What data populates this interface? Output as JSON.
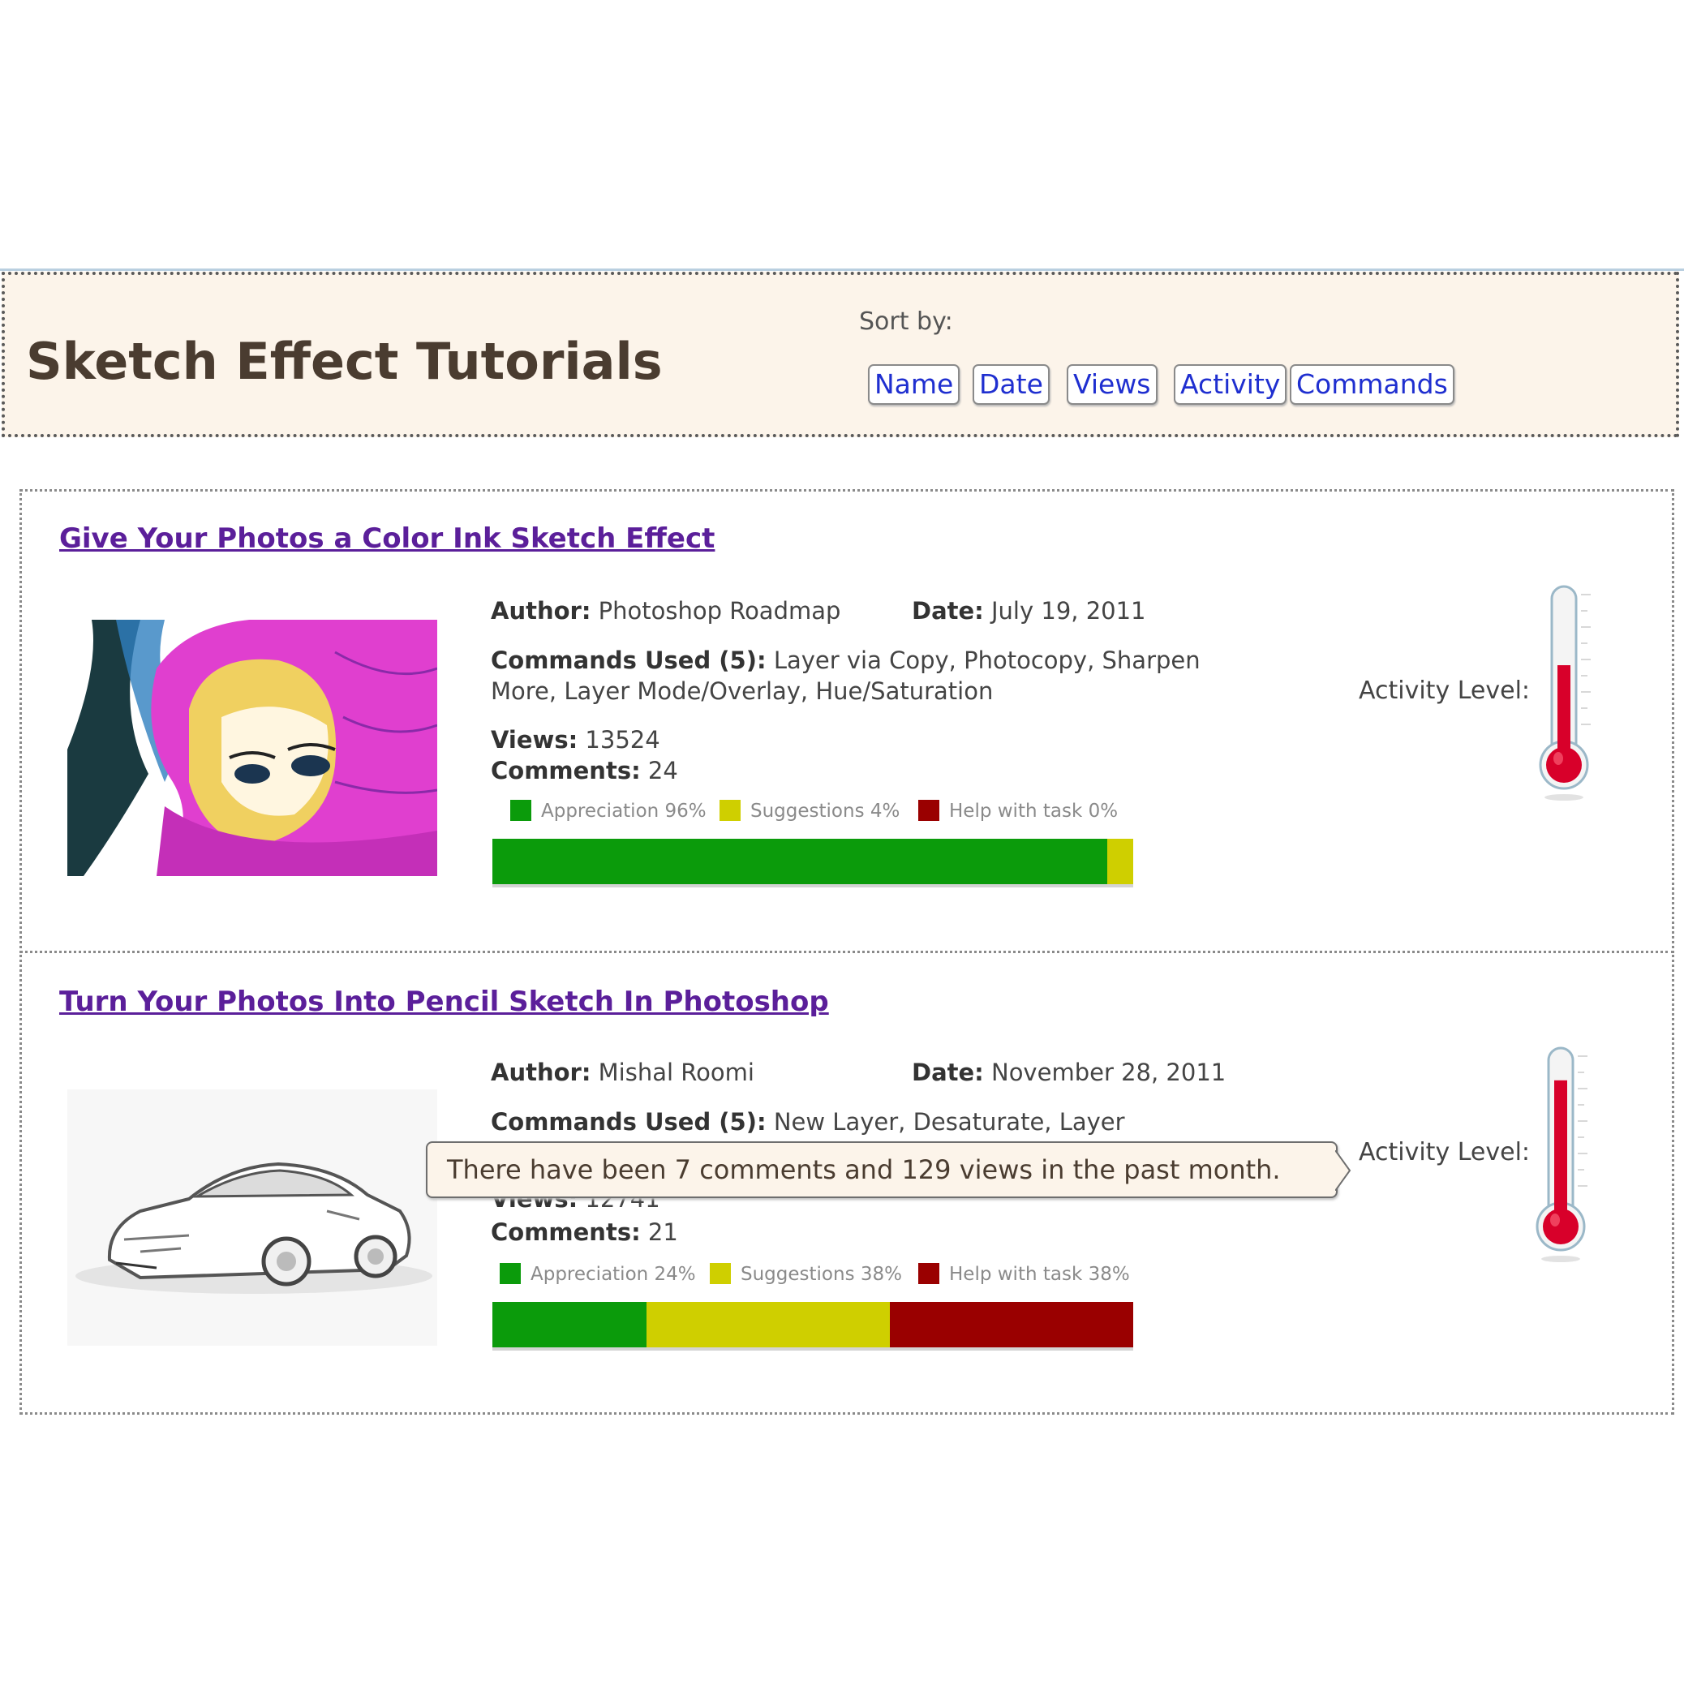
{
  "page": {
    "title": "Sketch Effect Tutorials"
  },
  "sort": {
    "label": "Sort by:",
    "buttons": [
      "Name",
      "Date",
      "Views",
      "Activity",
      "Commands"
    ]
  },
  "colors": {
    "appreciation": "#0b9b0b",
    "suggestions": "#cfcf00",
    "help": "#9a0000",
    "link": "#5b1f9a",
    "button_text": "#1f2fd0",
    "header_bg": "#fcf4ea"
  },
  "tutorials": [
    {
      "title": "Give Your Photos a Color Ink Sketch Effect",
      "author_label": "Author:",
      "author": "Photoshop Roadmap",
      "date_label": "Date:",
      "date": "July 19, 2011",
      "commands_label": "Commands Used (5):",
      "commands_line1": "Layer via Copy, Photocopy, Sharpen",
      "commands_line2": "More, Layer Mode/Overlay, Hue/Saturation",
      "views_label": "Views:",
      "views": "13524",
      "comments_label": "Comments:",
      "comments": "24",
      "legend": {
        "appreciation": "Appreciation 96%",
        "suggestions": "Suggestions 4%",
        "help": "Help with task 0%"
      },
      "breakdown": {
        "appreciation": 96,
        "suggestions": 4,
        "help": 0
      },
      "activity_label": "Activity Level:",
      "activity_level": 0.58,
      "thumbnail_icon": "color-ink-portrait-image"
    },
    {
      "title": "Turn Your Photos Into Pencil Sketch In Photoshop",
      "author_label": "Author:",
      "author": "Mishal Roomi",
      "date_label": "Date:",
      "date": "November 28, 2011",
      "commands_label": "Commands Used (5):",
      "commands_line1": "New Layer, Desaturate, Layer",
      "views_label": "Views:",
      "views": "12741",
      "comments_label": "Comments:",
      "comments": "21",
      "legend": {
        "appreciation": "Appreciation 24%",
        "suggestions": "Suggestions 38%",
        "help": "Help with task 38%"
      },
      "breakdown": {
        "appreciation": 24,
        "suggestions": 38,
        "help": 38
      },
      "activity_label": "Activity Level:",
      "activity_level": 0.85,
      "thumbnail_icon": "pencil-sketch-car-image"
    }
  ],
  "tooltip": {
    "text": "There have been 7 comments and 129 views in the past month."
  }
}
